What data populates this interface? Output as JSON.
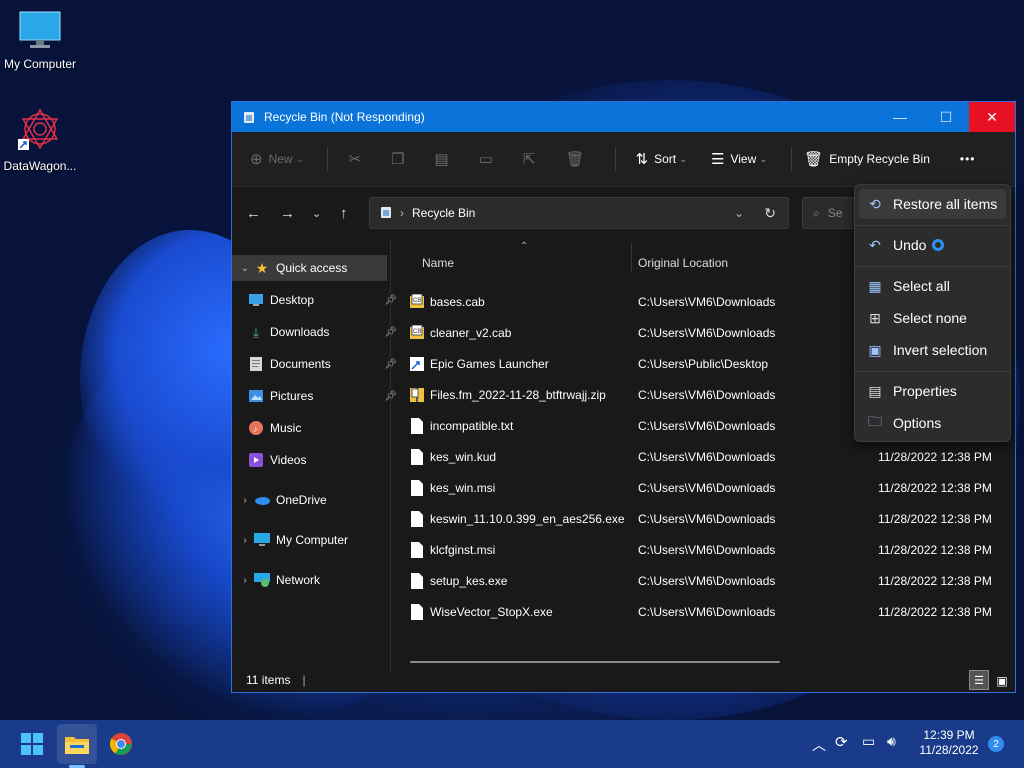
{
  "desktop": {
    "icons": [
      {
        "label": "My Computer",
        "icon": "monitor-icon"
      },
      {
        "label": "DataWagon...",
        "icon": "datawagon-shortcut-icon"
      }
    ]
  },
  "window": {
    "title": "Recycle Bin (Not Responding)",
    "controls": {
      "minimize": "—",
      "maximize": "☐",
      "close": "✕"
    }
  },
  "toolbar": {
    "new_label": "New",
    "sort_label": "Sort",
    "view_label": "View",
    "empty_label": "Empty Recycle Bin",
    "more_label": "•••"
  },
  "address": {
    "path": "Recycle Bin",
    "search_placeholder": "Se"
  },
  "navpane": {
    "quick_access": "Quick access",
    "items": [
      {
        "label": "Desktop",
        "pinned": true
      },
      {
        "label": "Downloads",
        "pinned": true
      },
      {
        "label": "Documents",
        "pinned": true
      },
      {
        "label": "Pictures",
        "pinned": true
      },
      {
        "label": "Music",
        "pinned": false
      },
      {
        "label": "Videos",
        "pinned": false
      }
    ],
    "onedrive": "OneDrive",
    "my_computer": "My Computer",
    "network": "Network"
  },
  "columns": {
    "name": "Name",
    "original_location": "Original Location"
  },
  "files": [
    {
      "name": "bases.cab",
      "location": "C:\\Users\\VM6\\Downloads",
      "date": ""
    },
    {
      "name": "cleaner_v2.cab",
      "location": "C:\\Users\\VM6\\Downloads",
      "date": ""
    },
    {
      "name": "Epic Games Launcher",
      "location": "C:\\Users\\Public\\Desktop",
      "date": ""
    },
    {
      "name": "Files.fm_2022-11-28_btftrwajj.zip",
      "location": "C:\\Users\\VM6\\Downloads",
      "date": ""
    },
    {
      "name": "incompatible.txt",
      "location": "C:\\Users\\VM6\\Downloads",
      "date": ""
    },
    {
      "name": "kes_win.kud",
      "location": "C:\\Users\\VM6\\Downloads",
      "date": "11/28/2022 12:38 PM"
    },
    {
      "name": "kes_win.msi",
      "location": "C:\\Users\\VM6\\Downloads",
      "date": "11/28/2022 12:38 PM"
    },
    {
      "name": "keswin_11.10.0.399_en_aes256.exe",
      "location": "C:\\Users\\VM6\\Downloads",
      "date": "11/28/2022 12:38 PM"
    },
    {
      "name": "klcfginst.msi",
      "location": "C:\\Users\\VM6\\Downloads",
      "date": "11/28/2022 12:38 PM"
    },
    {
      "name": "setup_kes.exe",
      "location": "C:\\Users\\VM6\\Downloads",
      "date": "11/28/2022 12:38 PM"
    },
    {
      "name": "WiseVector_StopX.exe",
      "location": "C:\\Users\\VM6\\Downloads",
      "date": "11/28/2022 12:38 PM"
    }
  ],
  "status": {
    "count": "11 items"
  },
  "menu": {
    "items": [
      {
        "label": "Restore all items",
        "icon": "restore-icon"
      },
      {
        "label": "Undo",
        "icon": "undo-icon"
      },
      {
        "label": "Select all",
        "icon": "select-all-icon"
      },
      {
        "label": "Select none",
        "icon": "select-none-icon"
      },
      {
        "label": "Invert selection",
        "icon": "invert-selection-icon"
      },
      {
        "label": "Properties",
        "icon": "properties-icon"
      },
      {
        "label": "Options",
        "icon": "options-icon"
      }
    ]
  },
  "taskbar": {
    "time": "12:39 PM",
    "date": "11/28/2022",
    "notifications": "2"
  },
  "colors": {
    "accent": "#0b74da",
    "close": "#e81123",
    "window_bg": "#191919"
  }
}
